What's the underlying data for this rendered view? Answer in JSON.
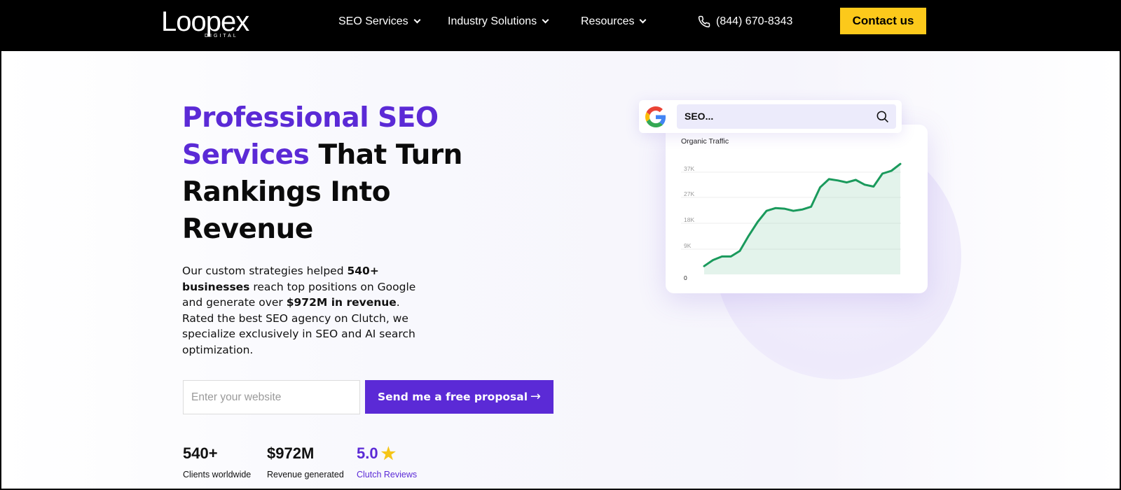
{
  "header": {
    "logo_text": "Loopex",
    "logo_sub": "DIGITAL",
    "nav": [
      {
        "label": "SEO Services"
      },
      {
        "label": "Industry Solutions"
      },
      {
        "label": "Resources"
      }
    ],
    "phone": "(844) 670-8343",
    "contact_label": "Contact us"
  },
  "hero": {
    "headline_accent": "Professional SEO Services",
    "headline_rest": "That Turn Rankings Into Revenue",
    "desc": {
      "p1": "Our custom strategies helped ",
      "b1": "540+ businesses",
      "p2": " reach top positions on Google and generate over ",
      "b2": "$972M in revenue",
      "p3": ". Rated the best SEO agency on Clutch, we specialize exclusively in SEO and AI search optimization."
    },
    "input_placeholder": "Enter your website",
    "cta_label": "Send me a free proposal",
    "cta_arrow": "→"
  },
  "stats": [
    {
      "value": "540+",
      "label": "Clients worldwide"
    },
    {
      "value": "$972M",
      "label": "Revenue generated"
    },
    {
      "value": "5.0",
      "label": "Clutch Reviews"
    }
  ],
  "colors": {
    "accent": "#5b2ad6",
    "cta_yellow": "#fcc91b",
    "chart_line": "#1a9a5c",
    "star": "#f5c518"
  },
  "search_widget": {
    "query": "SEO...",
    "icons": [
      "google-icon",
      "search-icon"
    ]
  },
  "chart_data": {
    "type": "area",
    "title": "Organic Traffic",
    "y_ticks": [
      "37K",
      "27K",
      "18K",
      "9K",
      "0"
    ],
    "ylim": [
      0,
      41000
    ],
    "x": [
      0,
      1,
      2,
      3,
      4,
      5,
      6,
      7,
      8,
      9,
      10,
      11,
      12,
      13,
      14,
      15,
      16,
      17,
      18,
      19,
      20,
      21,
      22
    ],
    "y": [
      3000,
      5200,
      6500,
      6500,
      8500,
      14000,
      19000,
      23000,
      24000,
      23800,
      23000,
      23500,
      24500,
      31500,
      34500,
      34000,
      33300,
      34200,
      32500,
      31800,
      36500,
      37500,
      40000
    ],
    "grid": true
  }
}
